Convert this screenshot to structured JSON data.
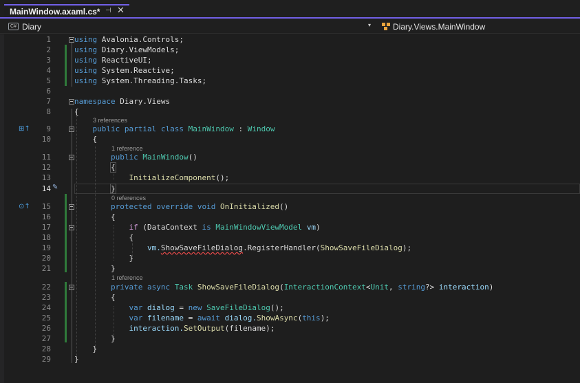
{
  "tab": {
    "title": "MainWindow.axaml.cs*",
    "pin": "⊣",
    "close": "✕"
  },
  "navbar": {
    "cs_badge": "C#",
    "project": "Diary",
    "dropdown": "▾",
    "member": "Diary.Views.MainWindow"
  },
  "editor": {
    "active_line": "14",
    "lines": [
      {
        "n": "1"
      },
      {
        "n": "2"
      },
      {
        "n": "3"
      },
      {
        "n": "4"
      },
      {
        "n": "5"
      },
      {
        "n": "6"
      },
      {
        "n": "7"
      },
      {
        "n": "8"
      },
      {
        "n": "9"
      },
      {
        "n": "10"
      },
      {
        "n": "11"
      },
      {
        "n": "12"
      },
      {
        "n": "13"
      },
      {
        "n": "14"
      },
      {
        "n": "15"
      },
      {
        "n": "16"
      },
      {
        "n": "17"
      },
      {
        "n": "18"
      },
      {
        "n": "19"
      },
      {
        "n": "20"
      },
      {
        "n": "21"
      },
      {
        "n": "22"
      },
      {
        "n": "23"
      },
      {
        "n": "24"
      },
      {
        "n": "25"
      },
      {
        "n": "26"
      },
      {
        "n": "27"
      },
      {
        "n": "28"
      },
      {
        "n": "29"
      }
    ],
    "codelens": {
      "class": "3 references",
      "ctor": "1 reference",
      "oninit": "0 references",
      "dialog": "1 reference"
    },
    "tokens": {
      "using": "using",
      "ns1": "Avalonia.Controls;",
      "ns2": "Diary.ViewModels;",
      "ns3": "ReactiveUI;",
      "ns4": "System.Reactive;",
      "ns5": "System.Threading.Tasks;",
      "namespace": "namespace",
      "ns_views": "Diary.Views",
      "public": "public",
      "partial": "partial",
      "class": "class",
      "main_window": "MainWindow",
      "colon": ":",
      "window": "Window",
      "open_brace": "{",
      "close_brace": "}",
      "parens": "()",
      "init_component": "InitializeComponent",
      "call_end": "();",
      "protected": "protected",
      "override": "override",
      "void": "void",
      "on_initialized": "OnInitialized",
      "if": "if",
      "datacontext": "(DataContext",
      "is": "is",
      "vm_type": "MainWindowViewModel",
      "vm": "vm",
      "rparen": ")",
      "vm_dot": "vm.",
      "show_save_cmd": "ShowSaveFileDialog",
      "register_handler": ".RegisterHandler(",
      "show_save_method": "ShowSaveFileDialog",
      "end_call": ");",
      "private": "private",
      "async": "async",
      "task": "Task",
      "interaction_ctx": "InteractionContext",
      "lt": "<",
      "unit": "Unit",
      "comma": ",",
      "string": "string",
      "q_gt": "?>",
      "interaction": "interaction",
      "var": "var",
      "dialog": "dialog",
      "eq": "=",
      "new": "new",
      "save_file_dialog": "SaveFileDialog",
      "filename": "filename",
      "await": "await",
      "dialog_dot": "dialog.",
      "show_async": "ShowAsync",
      "lparen": "(",
      "this": "this",
      "rparen_semi": ");",
      "interaction_dot": "interaction.",
      "set_output": "SetOutput",
      "filename_arg": "(filename);"
    }
  },
  "colors": {
    "accent": "#7160e8",
    "keyword": "#569cd6",
    "type": "#4ec9b0",
    "method": "#dcdcaa",
    "param": "#9cdcfe",
    "control": "#d8a0df"
  }
}
